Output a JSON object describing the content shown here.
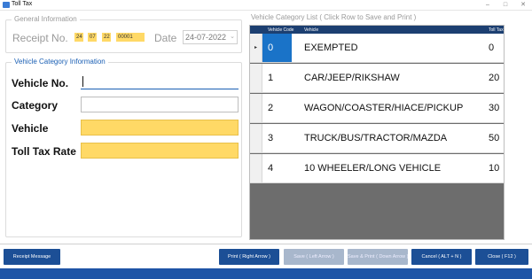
{
  "window": {
    "title": "Toll Tax",
    "minimize_glyph": "–",
    "maximize_glyph": "□",
    "close_glyph": "✕"
  },
  "general": {
    "legend": "General Information",
    "receipt_label": "Receipt No.",
    "receipt_parts": [
      "24",
      "07",
      "22",
      "00001"
    ],
    "date_label": "Date",
    "date_value": "24-07-2022"
  },
  "category_info": {
    "legend": "Vehicle Category Information",
    "vehicle_no_label": "Vehicle No.",
    "vehicle_no_value": "",
    "category_label": "Category",
    "category_value": "",
    "vehicle_label": "Vehicle",
    "vehicle_value": "",
    "toll_rate_label": "Toll Tax Rate",
    "toll_rate_value": ""
  },
  "list": {
    "legend": "Vehicle Category List ( Click Row to Save and Print )",
    "columns": {
      "code": "Vehicle Code",
      "vehicle": "Vehicle",
      "toll": "Toll Tax"
    },
    "rows": [
      {
        "code": "0",
        "vehicle": "EXEMPTED",
        "toll": "0"
      },
      {
        "code": "1",
        "vehicle": "CAR/JEEP/RIKSHAW",
        "toll": "20"
      },
      {
        "code": "2",
        "vehicle": "WAGON/COASTER/HIACE/PICKUP",
        "toll": "30"
      },
      {
        "code": "3",
        "vehicle": "TRUCK/BUS/TRACTOR/MAZDA",
        "toll": "50"
      },
      {
        "code": "4",
        "vehicle": "10 WHEELER/LONG VEHICLE",
        "toll": "10"
      }
    ],
    "selected_row_marker": "▸"
  },
  "buttons": {
    "receipt_message": "Receipt Message",
    "print": "Print ( Right Arrow )",
    "save": "Save ( Left Arrow )",
    "save_print": "Save & Print ( Down Arrow )",
    "cancel": "Cancel ( ALT + N )",
    "close": "Close ( F12 )"
  },
  "colors": {
    "accent_blue": "#1c4f96",
    "header_navy": "#1c3f71",
    "field_yellow": "#ffd966",
    "selected_cell": "#1a73c8",
    "legend_blue": "#1a5fb4"
  }
}
